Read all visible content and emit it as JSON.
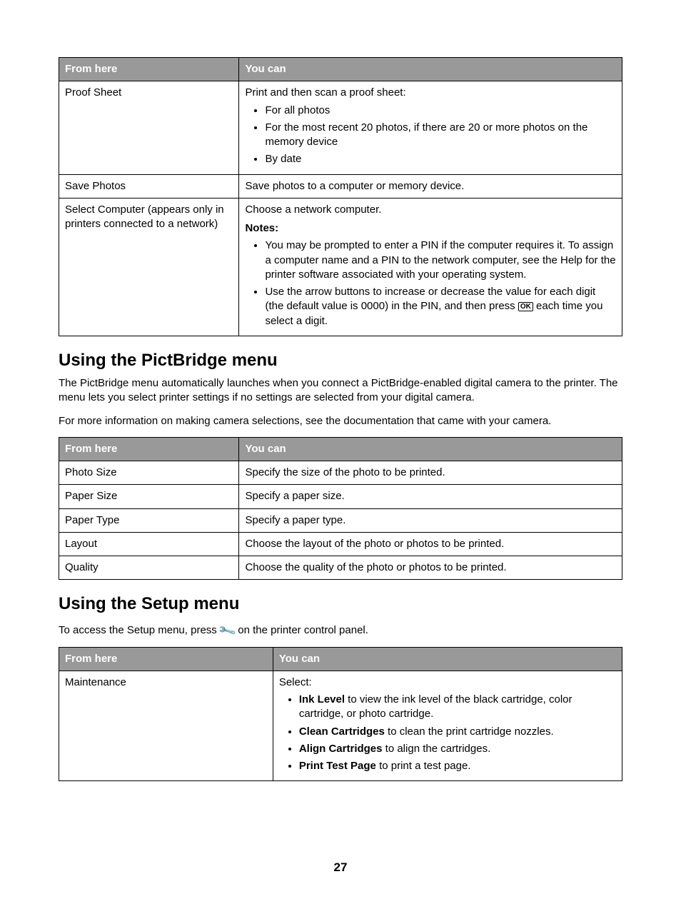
{
  "table1": {
    "header": {
      "c1": "From here",
      "c2": "You can"
    },
    "row1": {
      "name": "Proof Sheet",
      "lead": "Print and then scan a proof sheet:",
      "items": [
        "For all photos",
        "For the most recent 20 photos, if there are 20 or more photos on the memory device",
        "By date"
      ]
    },
    "row2": {
      "name": "Save Photos",
      "desc": "Save photos to a computer or memory device."
    },
    "row3": {
      "name": "Select Computer (appears only in printers connected to a network)",
      "lead": "Choose a network computer.",
      "notes_label": "Notes:",
      "notes": [
        "You may be prompted to enter a PIN if the computer requires it. To assign a computer name and a PIN to the network computer, see the Help for the printer software associated with your operating system.",
        "Use the arrow buttons to increase or decrease the value for each digit (the default value is 0000) in the PIN, and then press "
      ],
      "ok_label": "OK",
      "note2_tail": " each time you select a digit."
    }
  },
  "section1": {
    "title": "Using the PictBridge menu",
    "p1": "The PictBridge menu automatically launches when you connect a PictBridge-enabled digital camera to the printer. The menu lets you select printer settings if no settings are selected from your digital camera.",
    "p2": "For more information on making camera selections, see the documentation that came with your camera."
  },
  "table2": {
    "header": {
      "c1": "From here",
      "c2": "You can"
    },
    "rows": [
      {
        "name": "Photo Size",
        "desc": "Specify the size of the photo to be printed."
      },
      {
        "name": "Paper Size",
        "desc": "Specify a paper size."
      },
      {
        "name": "Paper Type",
        "desc": "Specify a paper type."
      },
      {
        "name": "Layout",
        "desc": "Choose the layout of the photo or photos to be printed."
      },
      {
        "name": "Quality",
        "desc": "Choose the quality of the photo or photos to be printed."
      }
    ]
  },
  "section2": {
    "title": "Using the Setup menu",
    "intro_pre": "To access the Setup menu, press ",
    "intro_post": " on the printer control panel."
  },
  "table3": {
    "header": {
      "c1": "From here",
      "c2": "You can"
    },
    "row1": {
      "name": "Maintenance",
      "lead": "Select:",
      "items": [
        {
          "bold": "Ink Level",
          "rest": " to view the ink level of the black cartridge, color cartridge, or photo cartridge."
        },
        {
          "bold": "Clean Cartridges",
          "rest": " to clean the print cartridge nozzles."
        },
        {
          "bold": "Align Cartridges",
          "rest": " to align the cartridges."
        },
        {
          "bold": "Print Test Page",
          "rest": " to print a test page."
        }
      ]
    }
  },
  "page_number": "27"
}
